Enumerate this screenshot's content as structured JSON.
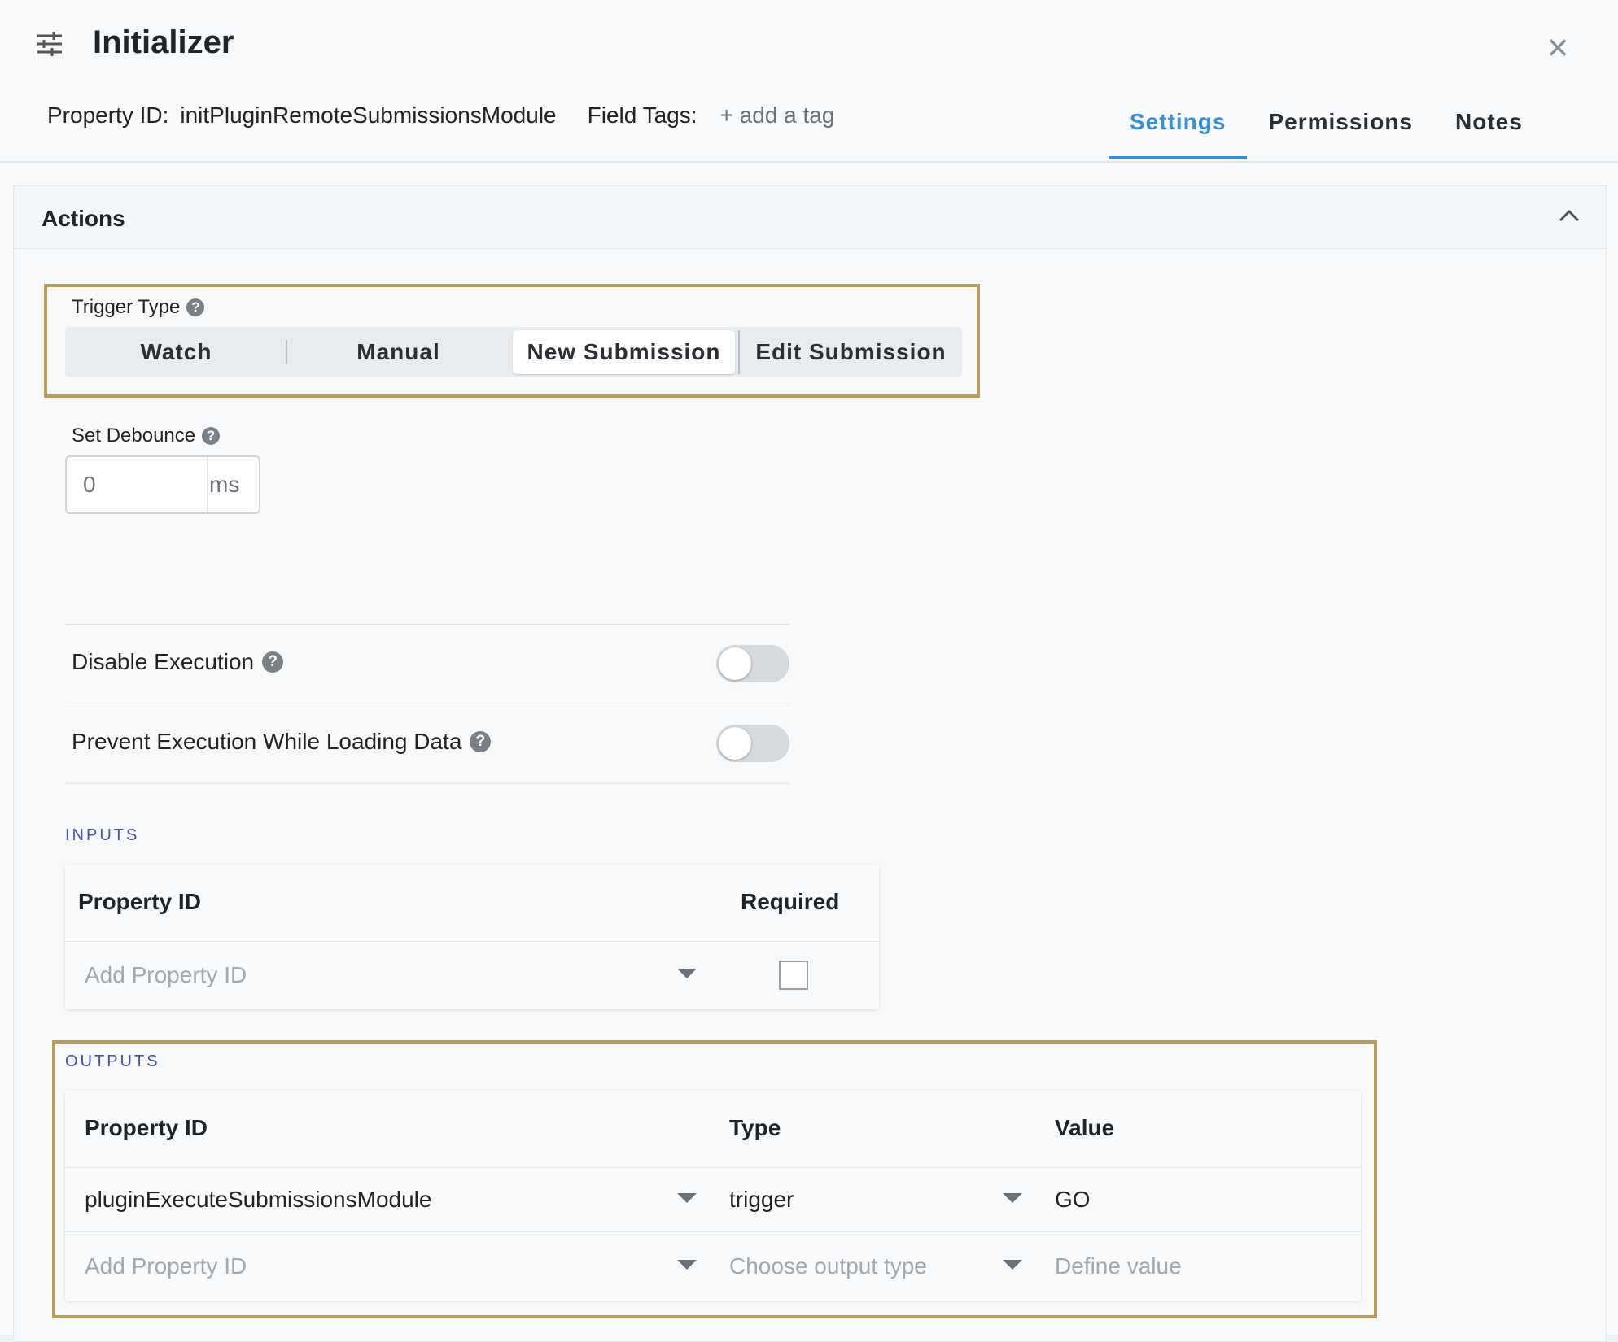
{
  "header": {
    "title": "Initializer",
    "property_id_label": "Property ID:",
    "property_id_value": "initPluginRemoteSubmissionsModule",
    "field_tags_label": "Field Tags:",
    "add_tag": "+ add a tag",
    "tabs": [
      {
        "label": "Settings",
        "active": true
      },
      {
        "label": "Permissions"
      },
      {
        "label": "Notes"
      }
    ]
  },
  "actions": {
    "section_label": "Actions",
    "trigger_type_label": "Trigger Type",
    "trigger_options": [
      "Watch",
      "Manual",
      "New Submission",
      "Edit Submission"
    ],
    "selected_trigger": "New Submission",
    "debounce_label": "Set Debounce",
    "debounce_placeholder": "0",
    "debounce_unit": "ms",
    "disable_execution_label": "Disable Execution",
    "disable_execution_on": false,
    "prevent_loading_label": "Prevent Execution While Loading Data",
    "prevent_loading_on": false
  },
  "inputs": {
    "title": "INPUTS",
    "columns": [
      "Property ID",
      "Required"
    ],
    "rows": [
      {
        "property_id_placeholder": "Add Property ID",
        "required": false
      }
    ]
  },
  "outputs": {
    "title": "OUTPUTS",
    "columns": [
      "Property ID",
      "Type",
      "Value"
    ],
    "rows": [
      {
        "property_id": "pluginExecuteSubmissionsModule",
        "type": "trigger",
        "value": "GO"
      },
      {
        "property_id": "Add Property ID",
        "type": "Choose output type",
        "value": "Define value"
      }
    ]
  },
  "colors": {
    "accent": "#3a8fd6",
    "highlight_border": "#b79e5e",
    "section_title": "#4a4fb3"
  }
}
